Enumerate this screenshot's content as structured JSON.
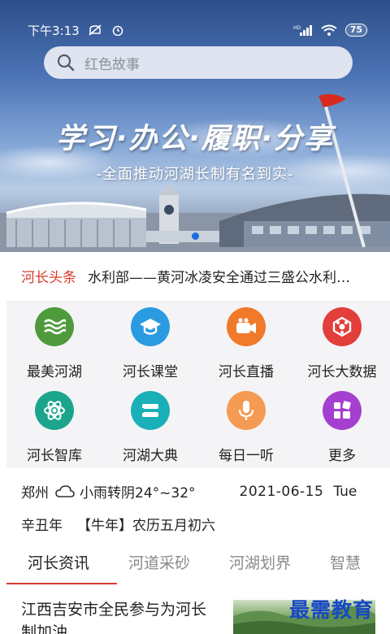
{
  "status_bar": {
    "time": "下午3:13",
    "network": "HD",
    "battery": "75"
  },
  "search": {
    "placeholder": "红色故事"
  },
  "banner": {
    "headline": "学习·办公·履职·分享",
    "subline": "-全面推动河湖长制有名到实-"
  },
  "ticker": {
    "tag": "河长头条",
    "headline": "水利部——黄河冰凌安全通过三盛公水利…"
  },
  "grid": {
    "items": [
      {
        "label": "最美河湖",
        "icon": "river-waves-icon",
        "color": "#4f9a3c"
      },
      {
        "label": "河长课堂",
        "icon": "graduation-cap-icon",
        "color": "#2a9be0"
      },
      {
        "label": "河长直播",
        "icon": "video-camera-icon",
        "color": "#f07a2a"
      },
      {
        "label": "河长大数据",
        "icon": "data-cube-icon",
        "color": "#e23e3a"
      },
      {
        "label": "河长智库",
        "icon": "atom-icon",
        "color": "#1aa58c"
      },
      {
        "label": "河湖大典",
        "icon": "book-stack-icon",
        "color": "#1ab0b8"
      },
      {
        "label": "每日一听",
        "icon": "microphone-icon",
        "color": "#f59a52"
      },
      {
        "label": "更多",
        "icon": "more-grid-icon",
        "color": "#a43fd0"
      }
    ]
  },
  "info": {
    "city": "郑州",
    "weather": "小雨转阴24°~32°",
    "weather_icon": "cloud-icon",
    "date": "2021-06-15",
    "weekday": "Tue",
    "year": "辛丑年",
    "zodiac": "【牛年】",
    "lunar": "农历五月初六"
  },
  "tabs": {
    "items": [
      "河长资讯",
      "河道采砂",
      "河湖划界",
      "智慧"
    ],
    "active_color": "#d83a2e"
  },
  "article": {
    "title": "江西吉安市全民参与为河长制加油"
  },
  "watermark": "最需教育"
}
